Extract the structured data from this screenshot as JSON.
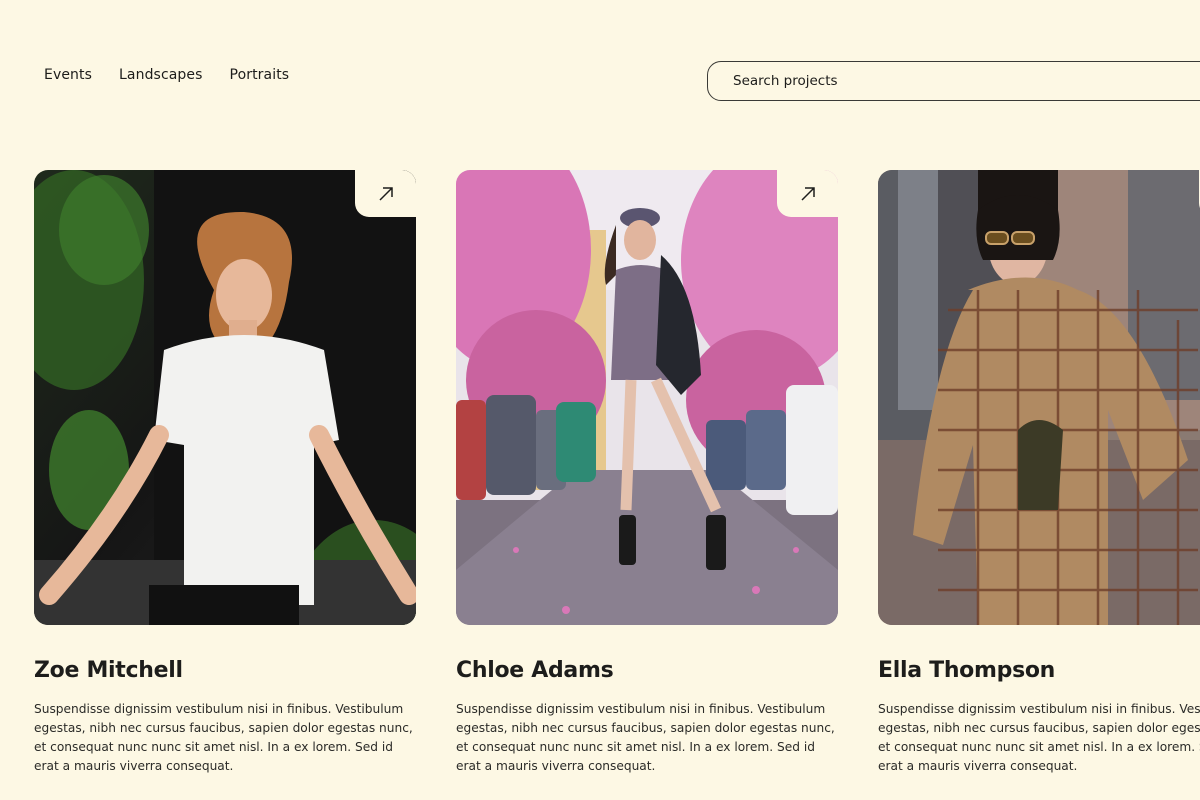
{
  "nav": {
    "items": [
      {
        "label": "Events"
      },
      {
        "label": "Landscapes"
      },
      {
        "label": "Portraits"
      }
    ]
  },
  "search": {
    "placeholder": "Search projects",
    "icon": "none"
  },
  "cards": [
    {
      "name": "Zoe Mitchell",
      "description": "Suspendisse dignissim vestibulum nisi in finibus. Vestibulum egestas, nibh nec cursus faucibus, sapien dolor egestas nunc, et consequat nunc nunc sit amet nisl. In a ex lorem. Sed id erat a mauris viverra consequat.",
      "action_icon": "arrow-up-right-icon"
    },
    {
      "name": "Chloe Adams",
      "description": "Suspendisse dignissim vestibulum nisi in finibus. Vestibulum egestas, nibh nec cursus faucibus, sapien dolor egestas nunc, et consequat nunc nunc sit amet nisl. In a ex lorem. Sed id erat a mauris viverra consequat.",
      "action_icon": "arrow-up-right-icon"
    },
    {
      "name": "Ella Thompson",
      "description": "Suspendisse dignissim vestibulum nisi in finibus. Vestibulum egestas, nibh nec cursus faucibus, sapien dolor egestas nunc, et consequat nunc nunc sit amet nisl. In a ex lorem. Sed id erat a mauris viverra consequat.",
      "action_icon": "arrow-up-right-icon"
    }
  ],
  "colors": {
    "background": "#fdf8e4",
    "text": "#1d1d1b",
    "border": "#3a3a36"
  }
}
